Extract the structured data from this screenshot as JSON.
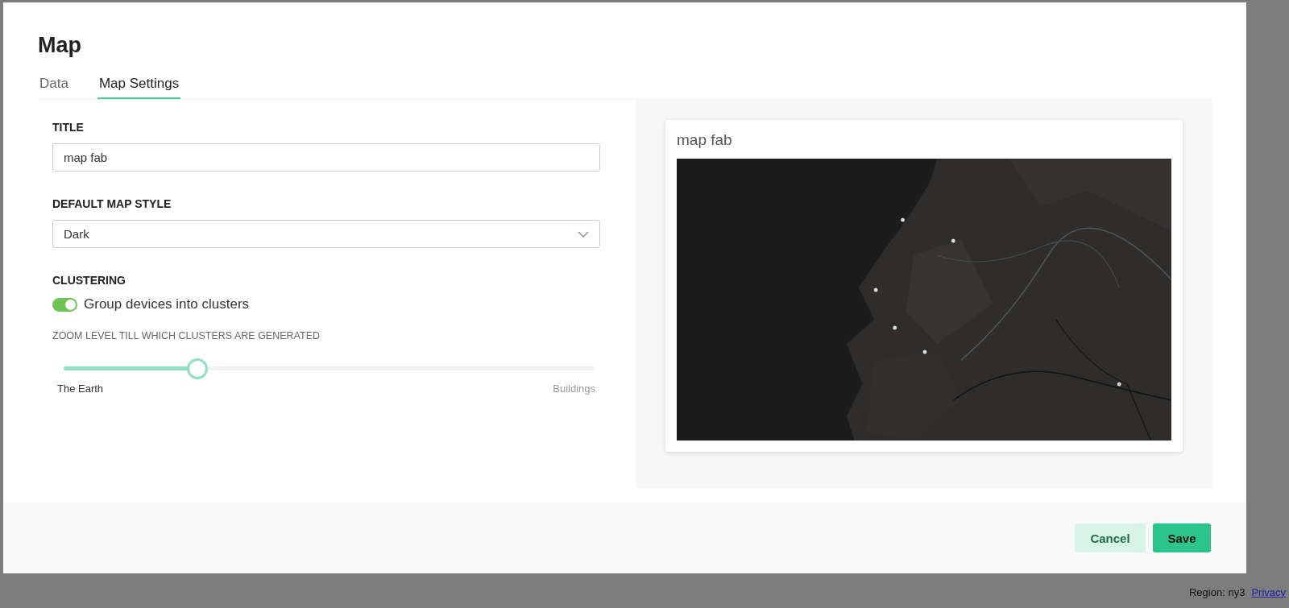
{
  "background": {
    "region": "Region: ny3",
    "link": "Privacy"
  },
  "dialog": {
    "title": "Map",
    "tabs": [
      {
        "label": "Data",
        "selected": false
      },
      {
        "label": "Map Settings",
        "selected": true
      }
    ],
    "title_field": {
      "label": "TITLE",
      "value": "map fab"
    },
    "style_field": {
      "label": "DEFAULT MAP STYLE",
      "value": "Dark"
    },
    "clustering": {
      "label": "CLUSTERING",
      "toggle_label": "Group devices into clusters",
      "on": true
    },
    "zoom_slider": {
      "label": "ZOOM LEVEL TILL WHICH CLUSTERS ARE GENERATED",
      "level": 0.25,
      "min_label": "The Earth",
      "max_label": "Buildings"
    },
    "preview": {
      "title": "map fab"
    },
    "buttons": [
      {
        "label": "Cancel",
        "kind": "secondary"
      },
      {
        "label": "Save",
        "kind": "primary"
      }
    ]
  }
}
